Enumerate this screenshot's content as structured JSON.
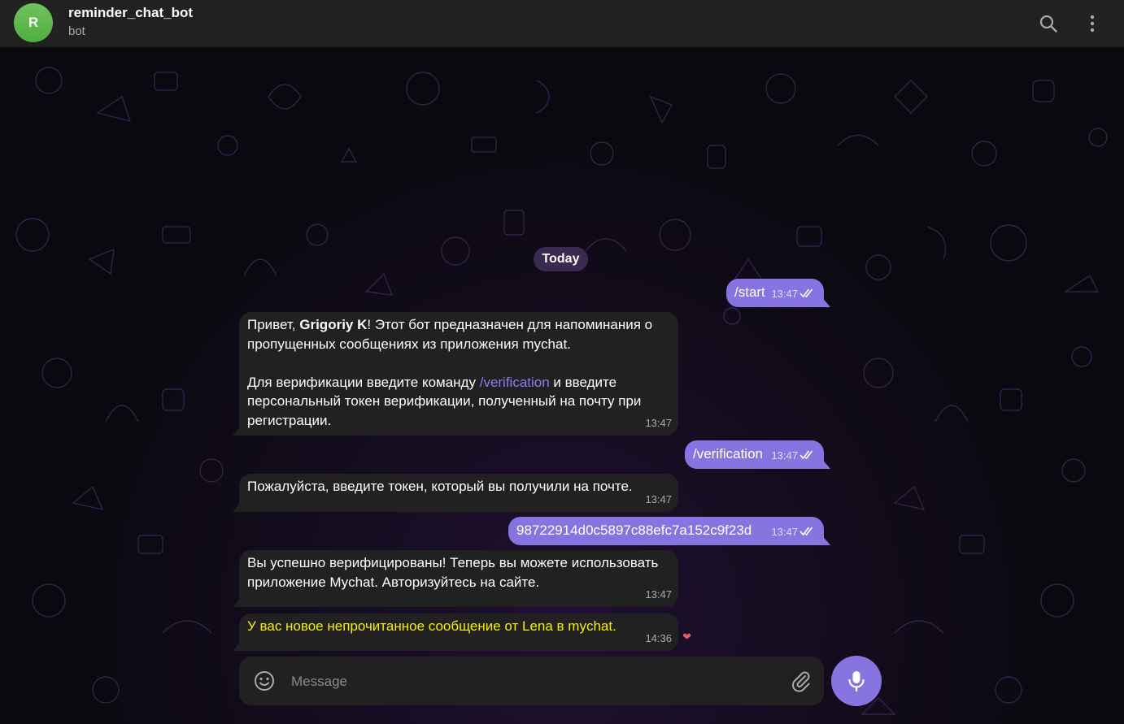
{
  "header": {
    "avatar_letter": "R",
    "title": "reminder_chat_bot",
    "subtitle": "bot",
    "search_icon": "search-icon",
    "menu_icon": "more-vertical-icon"
  },
  "chat": {
    "date_separator": "Today",
    "messages": [
      {
        "direction": "out",
        "text": "/start",
        "time": "13:47",
        "status": "read"
      },
      {
        "direction": "in",
        "p1_before": "Привет, ",
        "p1_name": "Grigoriy K",
        "p1_after": "! Этот бот предназначен для напоминания о пропущенных сообщениях из приложения mychat.",
        "p2_before": "Для верификации введите команду ",
        "p2_command": "/verification",
        "p2_after": " и введите персональный токен верификации, полученный на почту при регистрации.",
        "time": "13:47"
      },
      {
        "direction": "out",
        "text": "/verification",
        "time": "13:47",
        "status": "read"
      },
      {
        "direction": "in",
        "text": "Пожалуйста, введите токен, который вы получили на почте.",
        "time": "13:47"
      },
      {
        "direction": "out",
        "text": "98722914d0c5897c88efc7a152c9f23d",
        "time": "13:47",
        "status": "read"
      },
      {
        "direction": "in",
        "text": "Вы успешно верифицированы! Теперь вы можете использовать приложение Mychat. Авторизуйтесь на сайте.",
        "time": "13:47"
      },
      {
        "direction": "in",
        "text": "У вас новое непрочитанное сообщение от Lena в mychat.",
        "time": "14:36",
        "reaction": "❤"
      }
    ]
  },
  "composer": {
    "placeholder": "Message",
    "value": "",
    "emoji_icon": "smile-icon",
    "attach_icon": "paperclip-icon",
    "mic_icon": "microphone-icon"
  },
  "colors": {
    "header_bg": "#212121",
    "incoming_bubble": "#212121",
    "outgoing_bubble": "#8774e1",
    "accent": "#8774e1",
    "avatar": "#5cb84a",
    "highlight_text": "#f6f000"
  }
}
